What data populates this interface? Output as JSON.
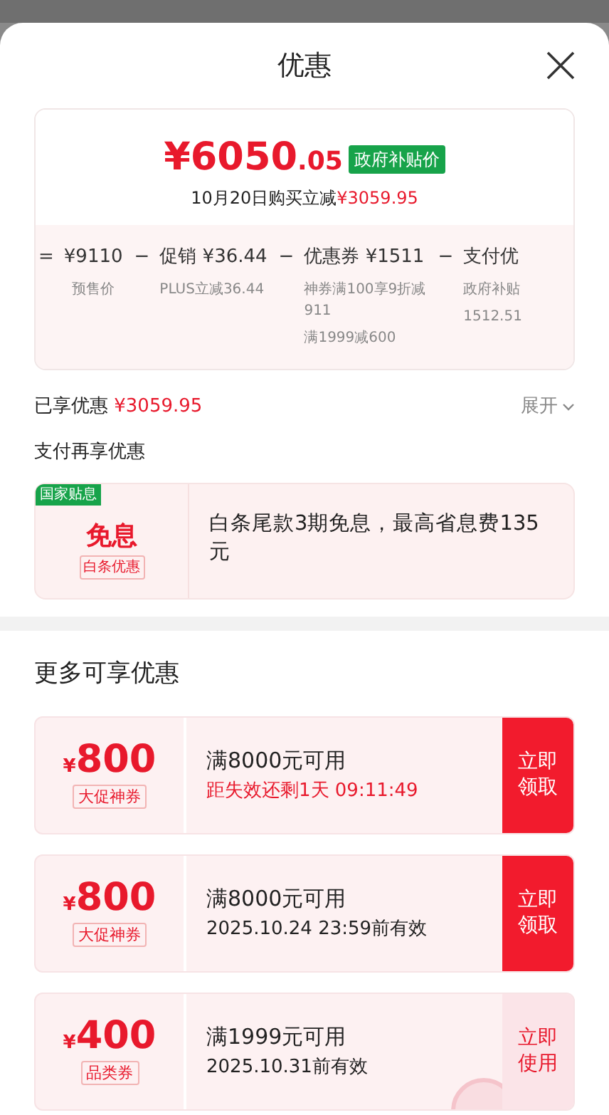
{
  "sheet": {
    "title": "优惠"
  },
  "price": {
    "main": "¥6050",
    "decimal": ".05",
    "tag": "政府补贴价",
    "subtitle_prefix": "10月20日购买立减",
    "subtitle_amount": "¥3059.95"
  },
  "breakdown": [
    {
      "op": "=",
      "title": "¥9110",
      "notes": [
        "预售价"
      ]
    },
    {
      "op": "−",
      "title": "促销 ¥36.44",
      "notes": [
        "PLUS立减36.44"
      ]
    },
    {
      "op": "−",
      "title": "优惠券 ¥1511",
      "notes": [
        "神券满100享9折减911",
        "满1999减600"
      ]
    },
    {
      "op": "−",
      "title": "支付优",
      "notes": [
        "政府补贴",
        "1512.51"
      ]
    }
  ],
  "enjoyed": {
    "label": "已享优惠",
    "amount": "¥3059.95",
    "toggle": "展开",
    "expanded": false
  },
  "pay_section": {
    "title": "支付再享优惠",
    "card": {
      "badge": "国家贴息",
      "headline": "免息",
      "tag": "白条优惠",
      "text": "白条尾款3期免息，最高省息费135元"
    }
  },
  "more": {
    "title": "更多可享优惠",
    "coupons": [
      {
        "currency": "¥",
        "amount": "800",
        "tag": "大促神券",
        "condition": "满8000元可用",
        "validity": "距失效还剩1天 09:11:49",
        "urgent": true,
        "claimed": false,
        "button": "立即领取"
      },
      {
        "currency": "¥",
        "amount": "800",
        "tag": "大促神券",
        "condition": "满8000元可用",
        "validity": "2025.10.24 23:59前有效",
        "urgent": false,
        "claimed": false,
        "button": "立即领取"
      },
      {
        "currency": "¥",
        "amount": "400",
        "tag": "品类券",
        "condition": "满1999元可用",
        "validity": "2025.10.31前有效",
        "urgent": false,
        "claimed": true,
        "button": "立即使用"
      }
    ]
  }
}
